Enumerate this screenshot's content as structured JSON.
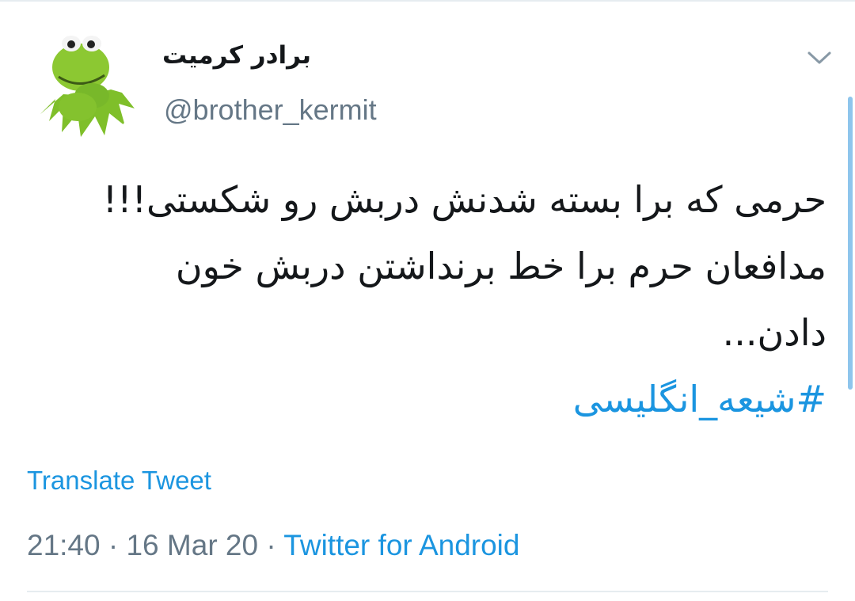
{
  "tweet": {
    "author_name": "برادر کرمیت",
    "handle": "@brother_kermit",
    "avatar_icon": "kermit-frog-avatar",
    "lines": [
      "حرمی که برا بسته شدنش دربش رو شکستی!!!",
      "مدافعان حرم برا خط برنداشتن دربش خون",
      "دادن..."
    ],
    "hashtag": "#شیعه_انگلیسی",
    "translate_label": "Translate Tweet",
    "time": "21:40",
    "date": "16 Mar 20",
    "separator": "·",
    "source": "Twitter for Android"
  },
  "colors": {
    "link": "#1b95e0",
    "muted": "#657786",
    "text": "#14171a",
    "divider": "#e6ecf0"
  },
  "icons": {
    "more_menu": "chevron-down-icon"
  }
}
